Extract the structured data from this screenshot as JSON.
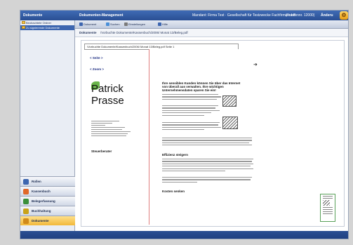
{
  "window": {
    "left_title": "Dokumente",
    "title": "Dokumenten-Management",
    "context": "Mandant: Firma Test · Gesellschaft für Testzwecke Fachfirma mbH",
    "code": "(Kundennr. 12000)",
    "trailing": "Änderu"
  },
  "sidebar": {
    "folders": [
      {
        "label": "Beobachtete Ordner",
        "selected": false
      },
      {
        "label": "Zu signierende Dokumente",
        "selected": true
      }
    ],
    "nav": [
      {
        "label": "Rollen",
        "color": "#3d66b0",
        "selected": false
      },
      {
        "label": "Kassenbuch",
        "color": "#e0682a",
        "selected": false
      },
      {
        "label": "Belegerfassung",
        "color": "#3a8f3a",
        "selected": false
      },
      {
        "label": "Buchhaltung",
        "color": "#c9a31a",
        "selected": false
      },
      {
        "label": "Dokumente",
        "color": "#d08a1a",
        "selected": true
      }
    ]
  },
  "toolbar": {
    "items": [
      {
        "label": "Dokument",
        "color": "#3d66b0"
      },
      {
        "label": "Suchen",
        "color": "#4a8fd8"
      },
      {
        "label": "Einstellungen",
        "color": "#7a7a7a"
      },
      {
        "label": "Hilfe",
        "color": "#3d66b0"
      }
    ]
  },
  "pathbar": {
    "label": "Dokumente",
    "path": "/Vorbuchte Dokumente/Kassenbuch/2006/ Monat 13/Beleg.pdf"
  },
  "viewer": {
    "path_field": "/Vorbuchte Dokumente/Kassenbuch/2006/ Monat 13/Beleg.pdf    Seite 1",
    "prev": "< Seite >",
    "zoom": "< Zoom >",
    "card": {
      "first": "Patrick",
      "last": "Prasse",
      "role": "Steuerberater"
    },
    "doc": {
      "heading1": "Ihre sensiblen Kunden können Sie über das Internet von überall aus verwalten. Ihre wichtigen Unternehmensdaten sparen Sie ein!",
      "heading2": "Effizienz steigern",
      "heading3": "Kosten senken"
    }
  }
}
